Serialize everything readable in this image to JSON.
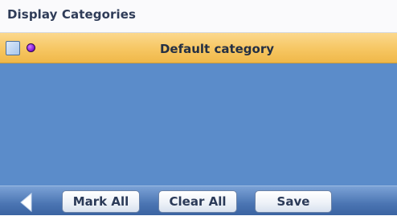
{
  "screen": {
    "title": "Display Categories"
  },
  "categories": [
    {
      "label": "Default category",
      "checked": false,
      "icon": "purple-dot-icon",
      "icon_color": "#9b30e6",
      "selected": true
    }
  ],
  "toolbar": {
    "back_icon": "back-arrow-icon",
    "mark_all_label": "Mark All",
    "clear_all_label": "Clear All",
    "save_label": "Save"
  },
  "colors": {
    "list_background": "#5b8cca",
    "selected_row": "#f6c662",
    "toolbar": "#4b75b3"
  }
}
